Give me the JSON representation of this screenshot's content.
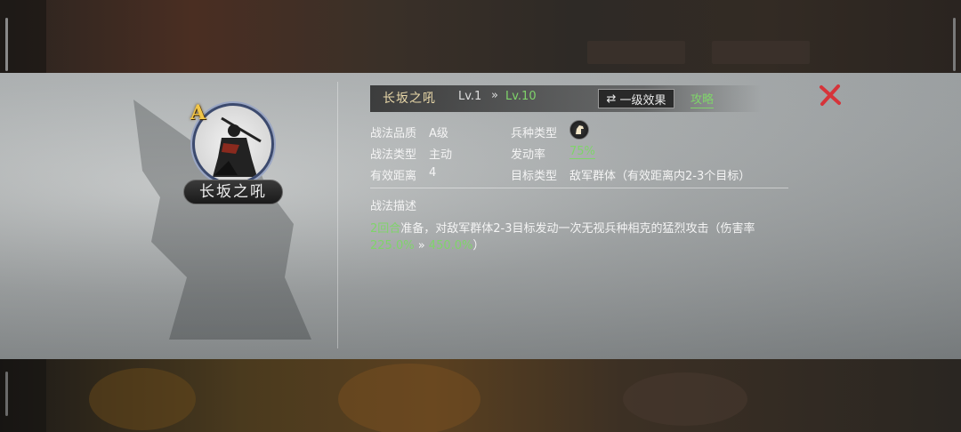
{
  "skill": {
    "grade": "A",
    "name": "长坂之吼",
    "level_label": "Lv.1",
    "level_arrow": "»",
    "level_max_label": "Lv.10"
  },
  "header": {
    "effect_button_label": "一级效果",
    "guide_link_label": "攻略"
  },
  "attributes": {
    "quality_label": "战法品质",
    "quality_value": "A级",
    "type_label": "战法类型",
    "type_value": "主动",
    "range_label": "有效距离",
    "range_value": "4",
    "troop_label": "兵种类型",
    "rate_label": "发动率",
    "rate_value": "75%",
    "target_label": "目标类型",
    "target_value": "敌军群体（有效距离内2-3个目标）"
  },
  "description": {
    "title": "战法描述",
    "prep_turns": "2回合",
    "text_main": "准备，对敌军群体2-3目标发动一次无视兵种相克的猛烈攻击（伤害率",
    "dmg_from": "225.0%",
    "dmg_arrow": " » ",
    "dmg_to": "450.0%",
    "text_end": "）"
  },
  "colors": {
    "accent_green": "#7fd46a",
    "grade_gold": "#f2c648",
    "close_red": "#d6343a"
  }
}
